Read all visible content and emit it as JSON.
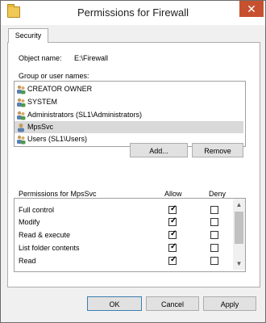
{
  "window": {
    "title": "Permissions for Firewall",
    "close_glyph": "✕"
  },
  "tab": {
    "label": "Security"
  },
  "object": {
    "label": "Object name:",
    "value": "E:\\Firewall"
  },
  "groups": {
    "label": "Group or user names:",
    "items": [
      {
        "label": "CREATOR OWNER",
        "icon": "users-group-icon"
      },
      {
        "label": "SYSTEM",
        "icon": "users-group-icon"
      },
      {
        "label": "Administrators (SL1\\Administrators)",
        "icon": "users-group-icon"
      },
      {
        "label": "MpsSvc",
        "icon": "user-icon",
        "selected": true
      },
      {
        "label": "Users (SL1\\Users)",
        "icon": "users-group-icon"
      }
    ]
  },
  "buttons": {
    "add": "Add...",
    "remove": "Remove",
    "ok": "OK",
    "cancel": "Cancel",
    "apply": "Apply"
  },
  "permissions": {
    "title": "Permissions for MpsSvc",
    "allow_header": "Allow",
    "deny_header": "Deny",
    "rows": [
      {
        "label": "Full control",
        "allow": true,
        "deny": false
      },
      {
        "label": "Modify",
        "allow": true,
        "deny": false
      },
      {
        "label": "Read & execute",
        "allow": true,
        "deny": false
      },
      {
        "label": "List folder contents",
        "allow": true,
        "deny": false
      },
      {
        "label": "Read",
        "allow": true,
        "deny": false
      }
    ],
    "scroll_up": "▲",
    "scroll_down": "▼"
  },
  "colors": {
    "close_button": "#c7502f",
    "selection": "#d9d9d9",
    "default_button_border": "#3c7fb1"
  }
}
